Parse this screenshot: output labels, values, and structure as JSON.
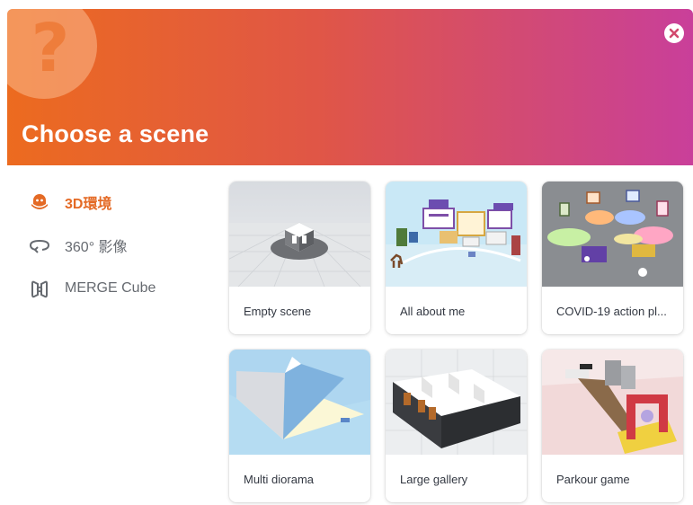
{
  "dialog": {
    "title": "Choose a scene",
    "header_mark": "?",
    "close_icon": "close-icon"
  },
  "sidebar": {
    "items": [
      {
        "label": "3D環境",
        "icon": "3d-environment-icon",
        "active": true
      },
      {
        "label": "360° 影像",
        "icon": "360-view-icon",
        "active": false
      },
      {
        "label": "MERGE Cube",
        "icon": "merge-cube-icon",
        "active": false
      }
    ]
  },
  "scenes": [
    {
      "label": "Empty scene"
    },
    {
      "label": "All about me"
    },
    {
      "label": "COVID-19 action pl..."
    },
    {
      "label": "Multi diorama"
    },
    {
      "label": "Large gallery"
    },
    {
      "label": "Parkour game"
    }
  ],
  "colors": {
    "accent": "#e46a25",
    "header_start": "#ec6b1f",
    "header_end": "#c93f9a",
    "text_muted": "#666a70"
  }
}
